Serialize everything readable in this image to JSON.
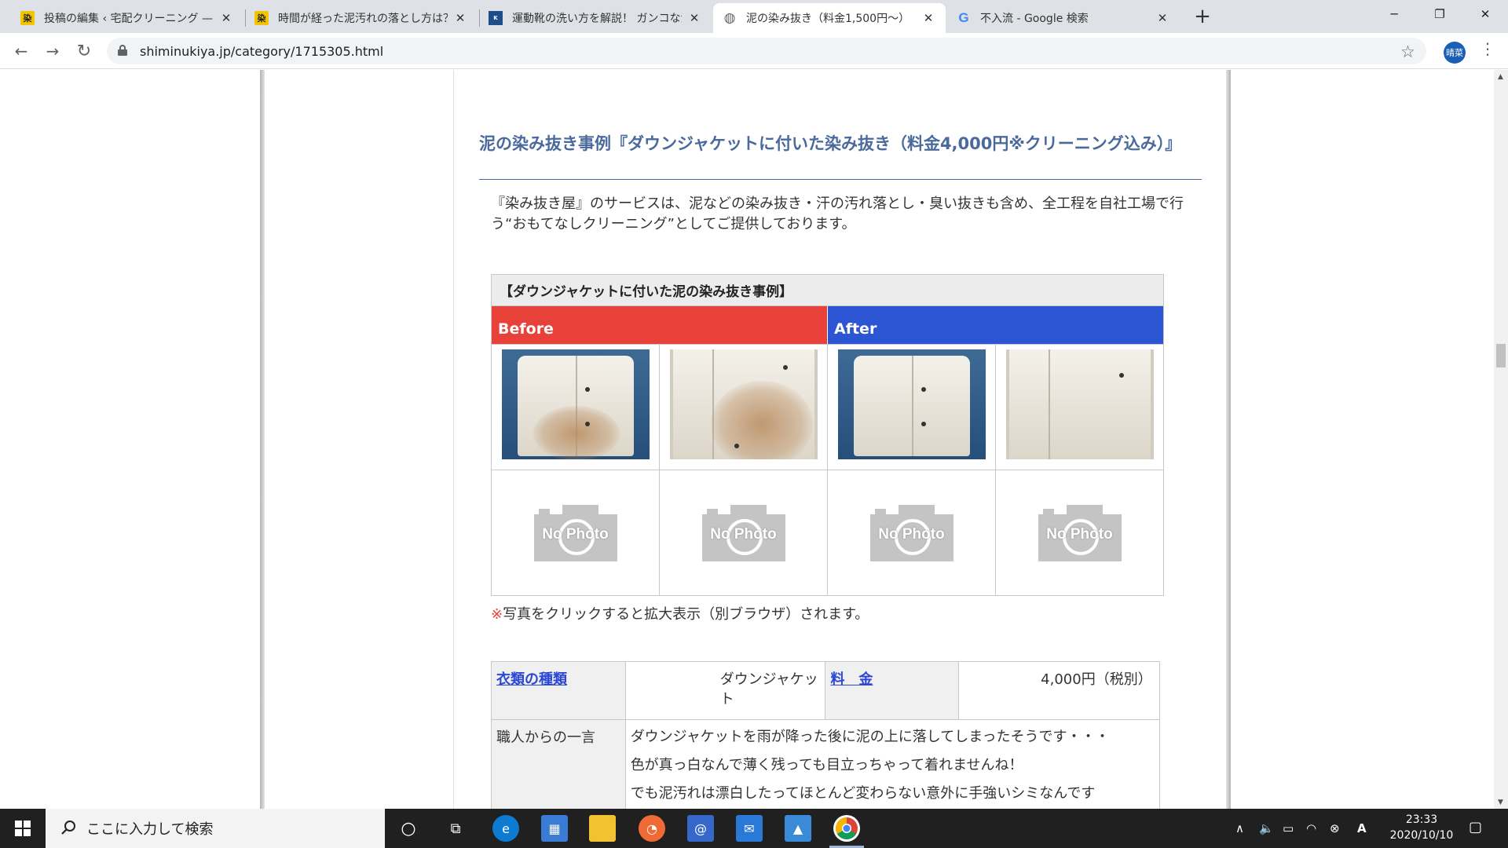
{
  "browser": {
    "tabs": [
      {
        "title": "投稿の編集 ‹ 宅配クリーニング — W",
        "favicon": "site-logo-icon",
        "active": false
      },
      {
        "title": "時間が経った泥汚れの落とし方は？",
        "favicon": "site-logo-icon",
        "active": false
      },
      {
        "title": "運動靴の洗い方を解説！ ガンコな汚",
        "favicon": "kaji-taku-icon",
        "active": false
      },
      {
        "title": "泥の染み抜き（料金1,500円～）",
        "favicon": "globe-icon",
        "active": true
      },
      {
        "title": "不入流 - Google 検索",
        "favicon": "google-icon",
        "active": false
      }
    ],
    "url": "shiminukiya.jp/category/1715305.html",
    "profile_initials": "晴菜"
  },
  "page": {
    "heading": "泥の染み抜き事例『ダウンジャケットに付いた染み抜き（料金4,000円※クリーニング込み）』",
    "intro": "『染み抜き屋』のサービスは、泥などの染み抜き・汗の汚れ落とし・臭い抜きも含め、全工程を自社工場で行う“おもてなしクリーニング”としてご提供しております。",
    "case_title": "【ダウンジャケットに付いた泥の染み抜き事例】",
    "before_label": "Before",
    "after_label": "After",
    "no_photo_text": "No Photo",
    "note_mark": "※",
    "note": "写真をクリックすると拡大表示（別ブラウザ）されます。",
    "spec": {
      "garment_label": "衣類の種類",
      "garment_value": "ダウンジャケット",
      "price_label": "料　金",
      "price_value": "4,000円（税別）",
      "comment_label": "職人からの一言",
      "comment_lines": [
        "ダウンジャケットを雨が降った後に泥の上に落してしまったそうです・・・",
        "色が真っ白なんで薄く残っても目立っちゃって着れませんね！",
        "でも泥汚れは漂白したってほとんど変わらない意外に手強いシミなんです"
      ]
    }
  },
  "colors": {
    "heading": "#4a6a9c",
    "before": "#e8413a",
    "after": "#2c55d4",
    "link": "#2a47d6"
  },
  "taskbar": {
    "search_placeholder": "ここに入力して検索",
    "time": "23:33",
    "date": "2020/10/10",
    "apps": [
      "task-view-icon",
      "edge-icon",
      "store-icon",
      "explorer-icon",
      "app-icon",
      "mail-app-icon",
      "mail-icon",
      "photos-icon",
      "chrome-icon"
    ]
  }
}
